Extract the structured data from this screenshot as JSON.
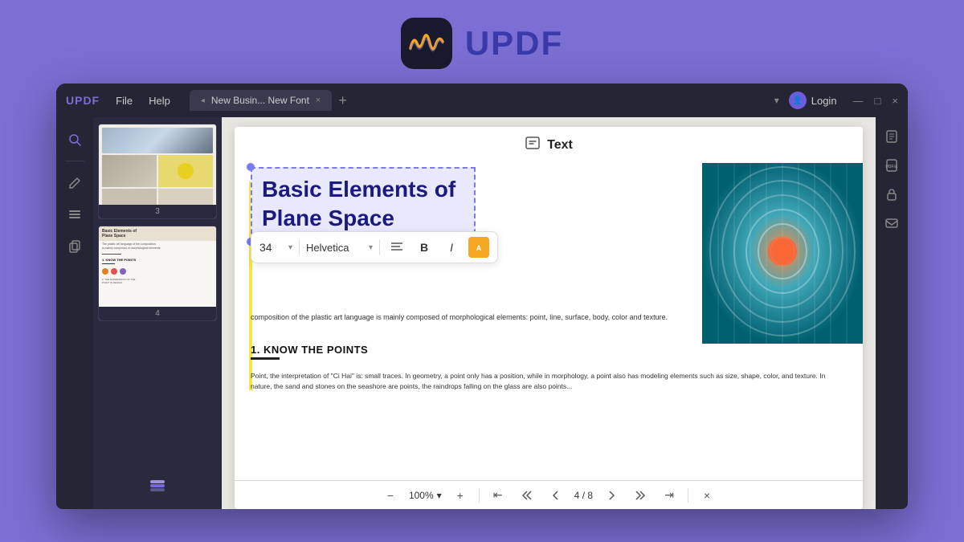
{
  "brand": {
    "app_name": "UPDF",
    "icon_emoji": "〰️"
  },
  "titlebar": {
    "logo": "UPDF",
    "menu": [
      "File",
      "Help"
    ],
    "tab_label": "New Busin... New Font",
    "tab_close": "×",
    "tab_add": "+",
    "login": "Login",
    "win_min": "—",
    "win_max": "□",
    "win_close": "×"
  },
  "sidebar_icons": [
    "🔍",
    "✏️",
    "📋",
    "📄"
  ],
  "text_toolbar": {
    "icon": "T",
    "label": "Text"
  },
  "selected_text": {
    "line1": "Basic Elements of",
    "line2": "Plane Space"
  },
  "format_toolbar": {
    "size": "34",
    "size_arrow": "▾",
    "font": "Helvetica",
    "font_arrow": "▾",
    "align_icon": "≡",
    "bold": "B",
    "italic": "I"
  },
  "page_content": {
    "body_intro": "composition of the plastic art language is mainly composed of morphological elements: point, line, surface, body, color and texture.",
    "section1_title": "1. KNOW THE POINTS",
    "body_paragraph": "Point, the interpretation of \"Ci Hai\" is: small traces. In geometry, a point only has a position, while in morphology, a point also has modeling elements such as size, shape, color, and texture. In nature, the sand and stones on the seashore are points, the raindrops falling on the glass are also points..."
  },
  "bottom_toolbar": {
    "zoom_out": "−",
    "zoom_level": "100%",
    "zoom_in": "+",
    "nav_first": "⇤",
    "nav_prev_prev": "↑↑",
    "nav_prev": "↑",
    "page_current": "4",
    "page_total": "8",
    "nav_next": "↓",
    "nav_next_next": "↓↓",
    "close": "×"
  },
  "right_panel_icons": [
    "📄",
    "📄",
    "🔒",
    "✉️"
  ],
  "thumbnail_pages": [
    {
      "num": "3"
    },
    {
      "num": "4"
    }
  ],
  "colors": {
    "accent_purple": "#7c6fd4",
    "bg_purple": "#7b6fd4",
    "titlebar_bg": "#252535",
    "selected_text_color": "#1a1a80",
    "selected_bg": "#e8e8ff"
  }
}
